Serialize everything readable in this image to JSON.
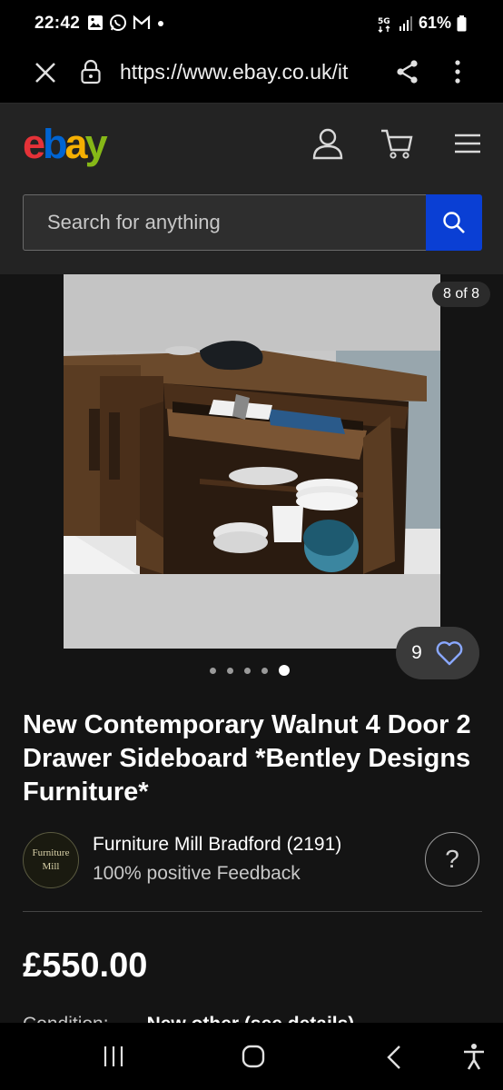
{
  "status_bar": {
    "time": "22:42",
    "battery": "61%",
    "network": "5G"
  },
  "browser": {
    "url": "https://www.ebay.co.uk/it"
  },
  "header": {
    "logo": {
      "e": "e",
      "b": "b",
      "a": "a",
      "y": "y"
    },
    "search_placeholder": "Search for anything"
  },
  "gallery": {
    "counter": "8 of 8",
    "watch_count": "9",
    "dots_total": 5,
    "active_dot": 5
  },
  "listing": {
    "title": "New Contemporary Walnut 4 Door 2 Drawer Sideboard *Bentley Designs Furniture*",
    "price": "£550.00",
    "condition_label": "Condition:",
    "condition_value": "New other (see details)"
  },
  "seller": {
    "avatar_line1": "Furniture",
    "avatar_line2": "Mill",
    "name": "Furniture Mill Bradford (2191)",
    "feedback": "100% positive Feedback",
    "help": "?"
  },
  "colors": {
    "ebay_red": "#e53238",
    "ebay_blue": "#0064d2",
    "ebay_yellow": "#f5af02",
    "ebay_green": "#86b817",
    "search_button": "#0a3fd4",
    "heart": "#8aa8ff"
  }
}
